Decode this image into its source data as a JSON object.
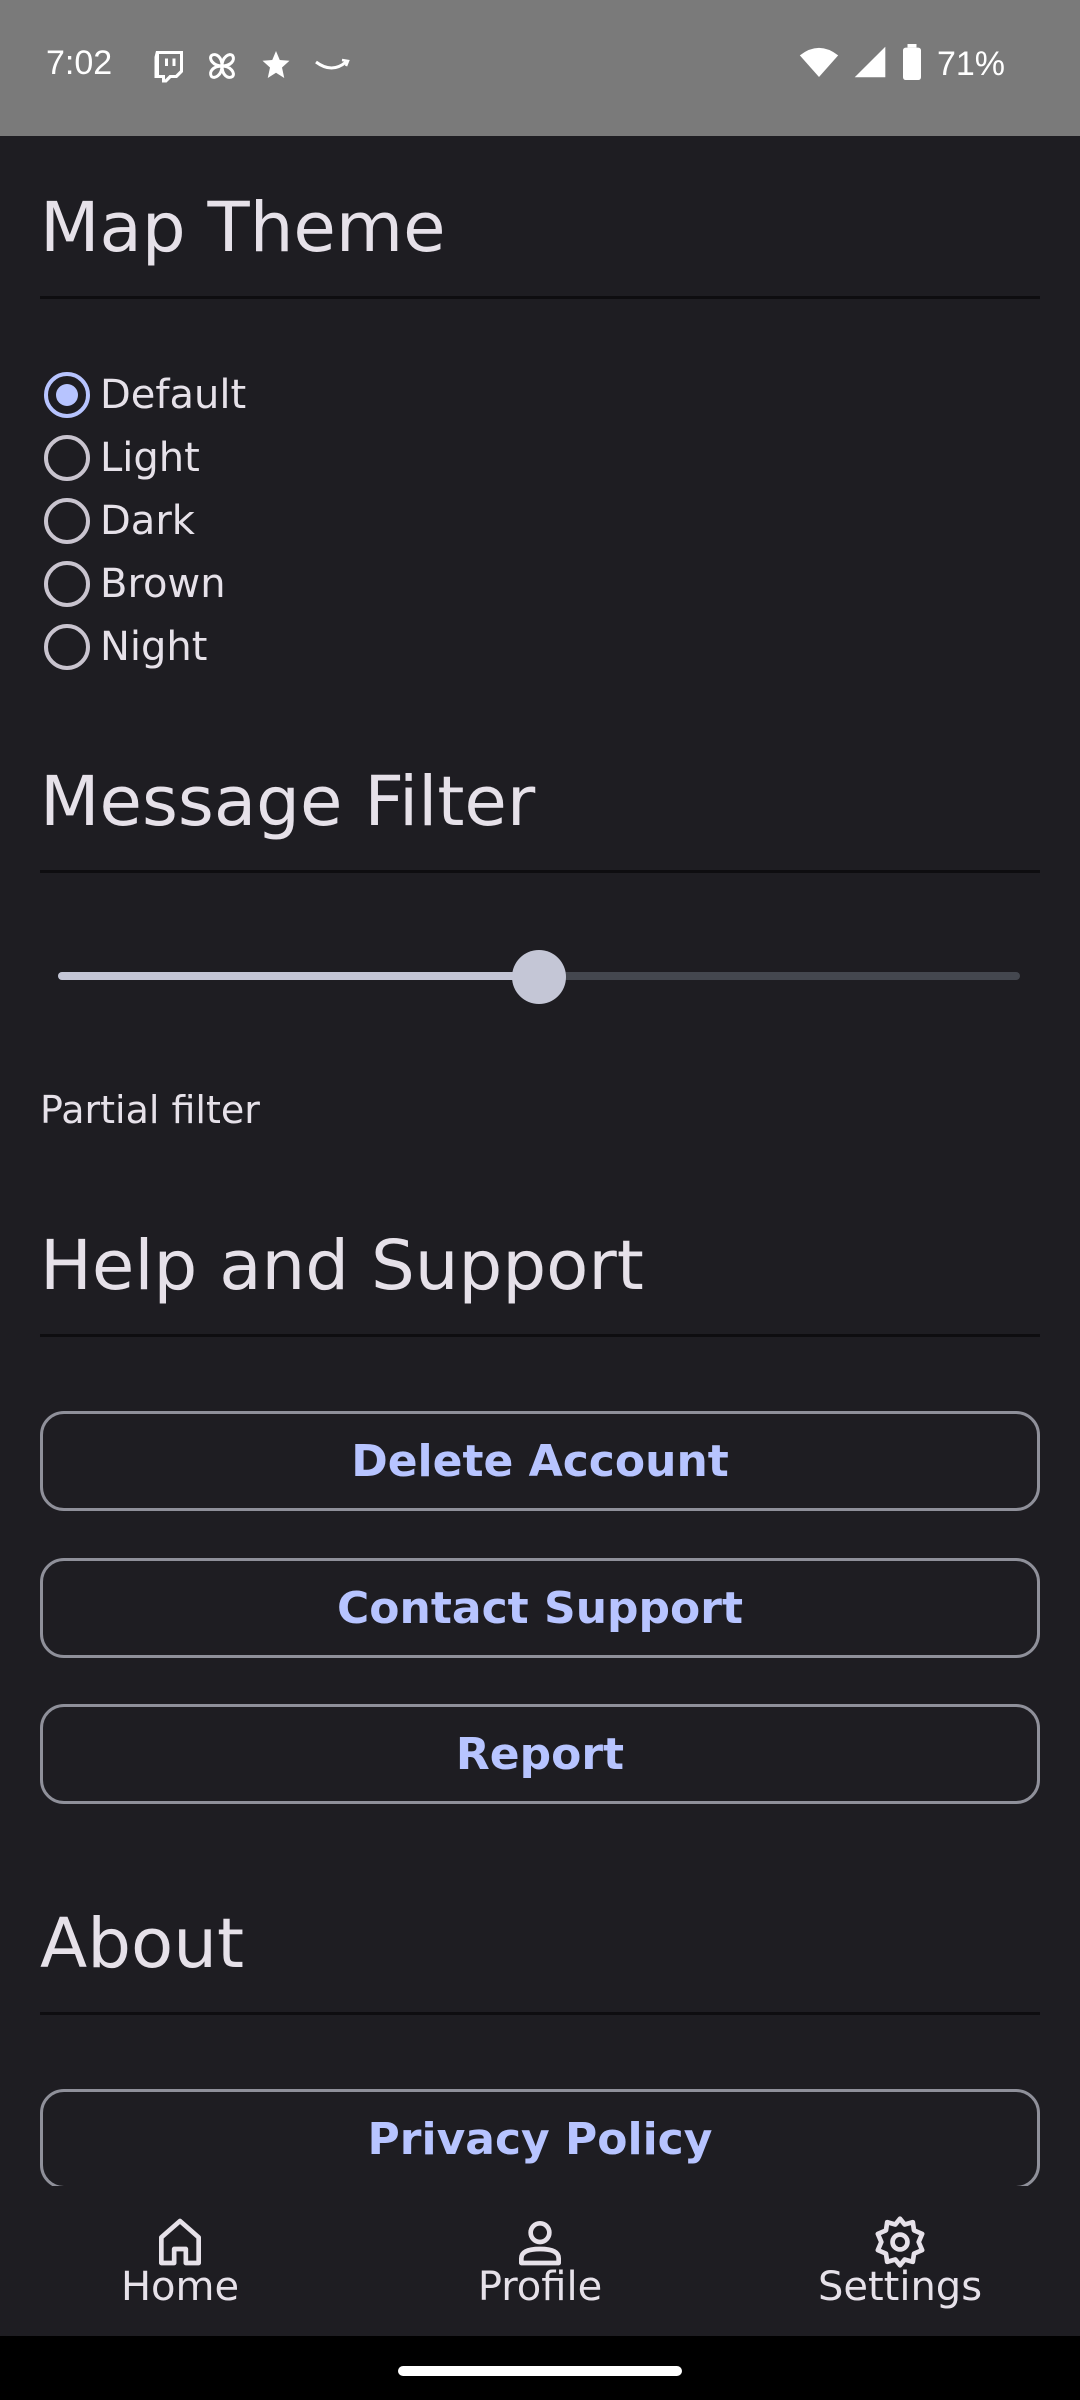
{
  "status_bar": {
    "time": "7:02",
    "battery_pct": "71%",
    "left_icons": [
      "twitch-icon",
      "pinwheel-icon",
      "puzzle-icon",
      "amazon-icon"
    ],
    "right_icons": [
      "wifi-icon",
      "signal-icon",
      "battery-icon"
    ]
  },
  "map_theme": {
    "title": "Map Theme",
    "options": [
      "Default",
      "Light",
      "Dark",
      "Brown",
      "Night"
    ],
    "selected": "Default"
  },
  "message_filter": {
    "title": "Message Filter",
    "slider_value": 0.5,
    "label": "Partial filter"
  },
  "help_support": {
    "title": "Help and Support",
    "buttons": [
      "Delete Account",
      "Contact Support",
      "Report"
    ]
  },
  "about": {
    "title": "About",
    "privacy_button": "Privacy Policy"
  },
  "bottom_nav": {
    "items": [
      {
        "label": "Home",
        "icon": "home-icon"
      },
      {
        "label": "Profile",
        "icon": "profile-icon"
      },
      {
        "label": "Settings",
        "icon": "settings-icon"
      }
    ]
  },
  "colors": {
    "background": "#1e1d22",
    "accent": "#b7c4ff",
    "status_bar": "#7a7a7a"
  }
}
